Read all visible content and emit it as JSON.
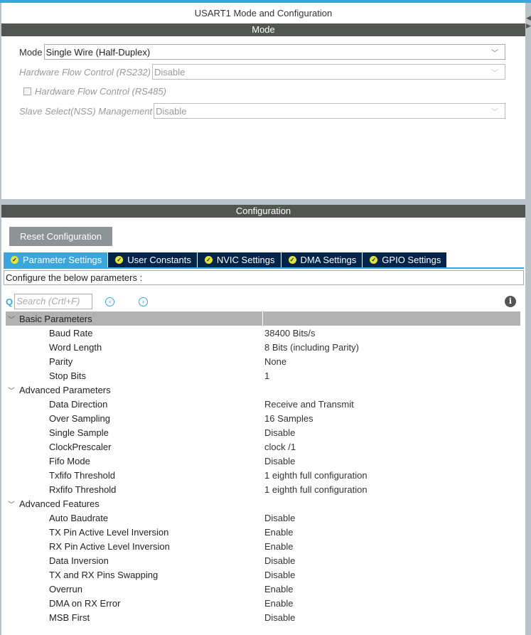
{
  "window_title": "USART1 Mode and Configuration",
  "mode_section": {
    "header": "Mode",
    "mode_label": "Mode",
    "mode_value": "Single Wire (Half-Duplex)",
    "hfc232_label": "Hardware Flow Control (RS232)",
    "hfc232_value": "Disable",
    "hfc485_label": "Hardware Flow Control (RS485)",
    "nss_label": "Slave Select(NSS) Management",
    "nss_value": "Disable"
  },
  "config_section": {
    "header": "Configuration",
    "reset_label": "Reset Configuration",
    "tabs": [
      "Parameter Settings",
      "User Constants",
      "NVIC Settings",
      "DMA Settings",
      "GPIO Settings"
    ],
    "description": "Configure the below parameters :",
    "search_placeholder": "Search (Crtl+F)"
  },
  "groups": [
    {
      "name": "Basic Parameters",
      "params": [
        [
          "Baud Rate",
          "38400 Bits/s"
        ],
        [
          "Word Length",
          "8 Bits (including Parity)"
        ],
        [
          "Parity",
          "None"
        ],
        [
          "Stop Bits",
          "1"
        ]
      ]
    },
    {
      "name": "Advanced Parameters",
      "params": [
        [
          "Data Direction",
          "Receive and Transmit"
        ],
        [
          "Over Sampling",
          "16 Samples"
        ],
        [
          "Single Sample",
          "Disable"
        ],
        [
          "ClockPrescaler",
          "clock /1"
        ],
        [
          "Fifo Mode",
          "Disable"
        ],
        [
          "Txfifo Threshold",
          "1 eighth full configuration"
        ],
        [
          "Rxfifo Threshold",
          "1 eighth full configuration"
        ]
      ]
    },
    {
      "name": "Advanced Features",
      "params": [
        [
          "Auto Baudrate",
          "Disable"
        ],
        [
          "TX Pin Active Level Inversion",
          "Enable"
        ],
        [
          "RX Pin Active Level Inversion",
          "Enable"
        ],
        [
          "Data Inversion",
          "Disable"
        ],
        [
          "TX and RX Pins Swapping",
          "Disable"
        ],
        [
          "Overrun",
          "Enable"
        ],
        [
          "DMA on RX Error",
          "Enable"
        ],
        [
          "MSB First",
          "Disable"
        ]
      ]
    }
  ]
}
